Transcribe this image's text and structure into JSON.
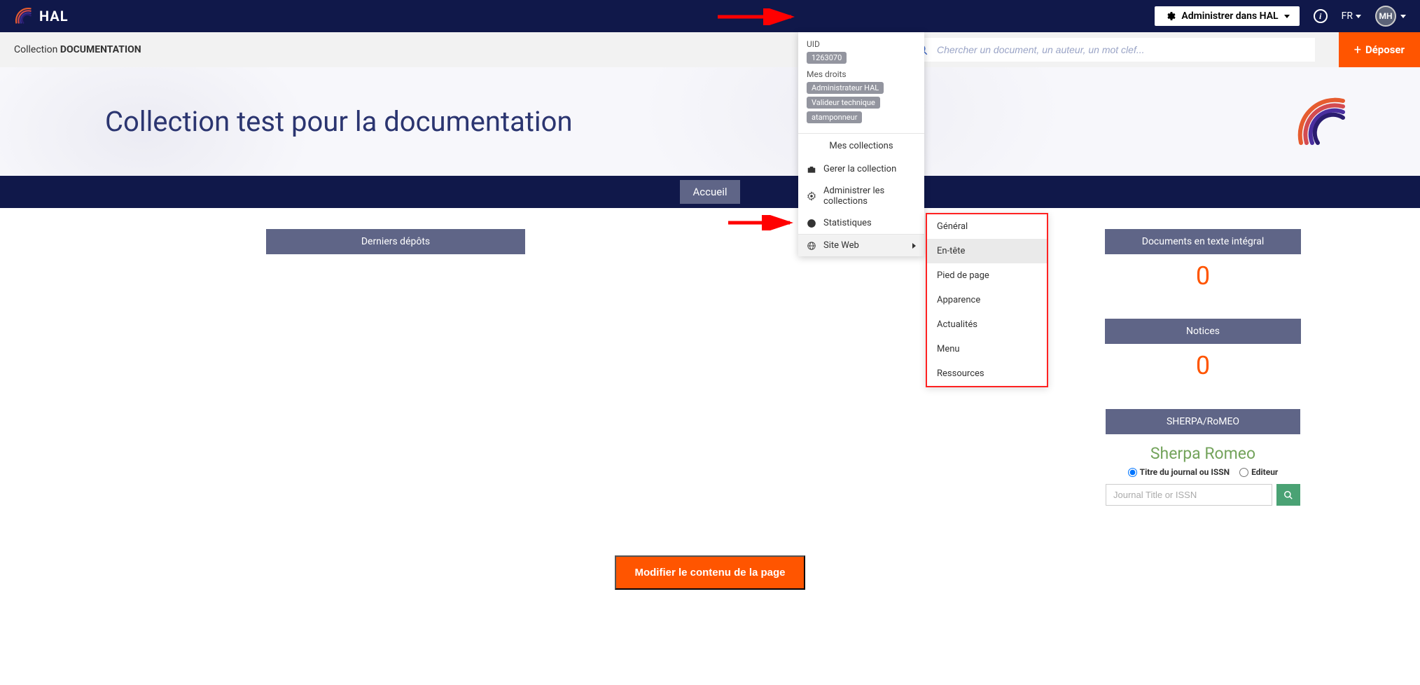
{
  "header": {
    "brand": "HAL",
    "admin_btn": "Administrer dans HAL",
    "lang": "FR",
    "avatar_initials": "MH"
  },
  "subheader": {
    "crumb_prefix": "Collection ",
    "crumb_name": "DOCUMENTATION",
    "search_placeholder": "Chercher un document, un auteur, un mot clef...",
    "deposit": "Déposer"
  },
  "hero": {
    "title": "Collection test pour la documentation"
  },
  "nav": {
    "accueil": "Accueil"
  },
  "widgets": {
    "derniers": "Derniers dépôts",
    "docs_label": "Documents en texte intégral",
    "docs_count": "0",
    "notices_label": "Notices",
    "notices_count": "0",
    "sherpa_label": "SHERPA/RoMEO",
    "sherpa_logo": "Sherpa Romeo",
    "radio_title": "Titre du journal ou ISSN",
    "radio_editeur": "Editeur",
    "sherpa_placeholder": "Journal Title or ISSN"
  },
  "modify_btn": "Modifier le contenu de la page",
  "dropdown": {
    "uid_label": "UID",
    "uid": "1263070",
    "droits_label": "Mes droits",
    "tag1": "Administrateur HAL",
    "tag2": "Valideur technique",
    "tag3": "atamponneur",
    "collections": "Mes collections",
    "gerer": "Gerer la collection",
    "administrer": "Administrer les collections",
    "stats": "Statistiques",
    "siteweb": "Site Web"
  },
  "submenu": {
    "general": "Général",
    "entete": "En-tête",
    "pied": "Pied de page",
    "apparence": "Apparence",
    "actualites": "Actualités",
    "menu": "Menu",
    "ressources": "Ressources"
  }
}
